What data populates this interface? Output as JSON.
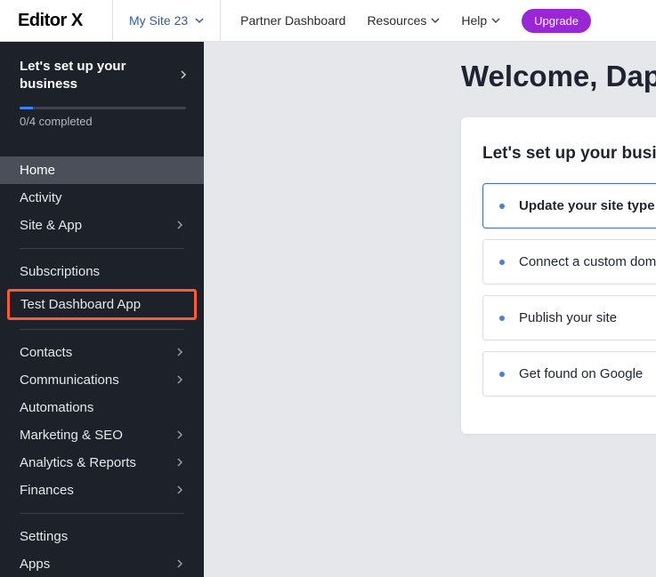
{
  "header": {
    "logo": "Editor X",
    "site_selector": "My Site 23",
    "nav": {
      "partner": "Partner Dashboard",
      "resources": "Resources",
      "help": "Help"
    },
    "upgrade": "Upgrade"
  },
  "sidebar": {
    "setup": {
      "title": "Let's set up your business",
      "counter": "0/4 completed"
    },
    "items": {
      "home": "Home",
      "activity": "Activity",
      "site_app": "Site & App",
      "subscriptions": "Subscriptions",
      "test_dashboard": "Test Dashboard App",
      "contacts": "Contacts",
      "communications": "Communications",
      "automations": "Automations",
      "marketing": "Marketing & SEO",
      "analytics": "Analytics & Reports",
      "finances": "Finances",
      "settings": "Settings",
      "apps": "Apps"
    }
  },
  "content": {
    "welcome": "Welcome, Daphne",
    "panel_title": "Let's set up your business",
    "tasks": {
      "t1": "Update your site type",
      "t2": "Connect a custom domain",
      "t3": "Publish your site",
      "t4": "Get found on Google"
    }
  }
}
